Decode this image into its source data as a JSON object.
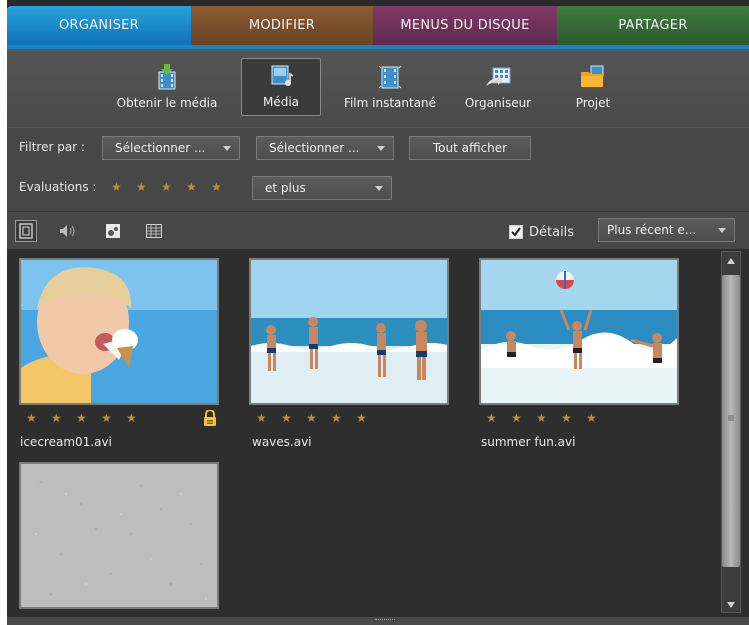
{
  "tabs": [
    {
      "label": "ORGANISER"
    },
    {
      "label": "MODIFIER"
    },
    {
      "label": "MENUS DU DISQUE"
    },
    {
      "label": "PARTAGER"
    }
  ],
  "toolbar": {
    "items": [
      {
        "label": "Obtenir le média",
        "icon": "import-media-icon"
      },
      {
        "label": "Média",
        "icon": "media-icon",
        "active": true
      },
      {
        "label": "Film instantané",
        "icon": "instant-movie-icon"
      },
      {
        "label": "Organiseur",
        "icon": "organizer-icon"
      },
      {
        "label": "Projet",
        "icon": "project-folder-icon"
      }
    ]
  },
  "filters": {
    "filter_label": "Filtrer par :",
    "select1": "Sélectionner ...",
    "select2": "Sélectionner ...",
    "show_all": "Tout afficher",
    "ratings_label": "Evaluations :",
    "ratings_select": "et plus",
    "rating_stars": 5
  },
  "viewbar": {
    "details_label": "Détails",
    "details_checked": true,
    "sort_select": "Plus récent e..."
  },
  "media": [
    {
      "filename": "icecream01.avi",
      "stars": 5,
      "locked": true
    },
    {
      "filename": "waves.avi",
      "stars": 5,
      "locked": false
    },
    {
      "filename": "summer fun.avi",
      "stars": 5,
      "locked": false
    },
    {
      "filename": "",
      "stars": 0,
      "locked": false
    }
  ],
  "colors": {
    "tab_organiser": "#1584c9",
    "tab_modifier": "#7a5030",
    "tab_menus": "#6e3259",
    "tab_partager": "#356a36",
    "star": "#c08a3a"
  }
}
